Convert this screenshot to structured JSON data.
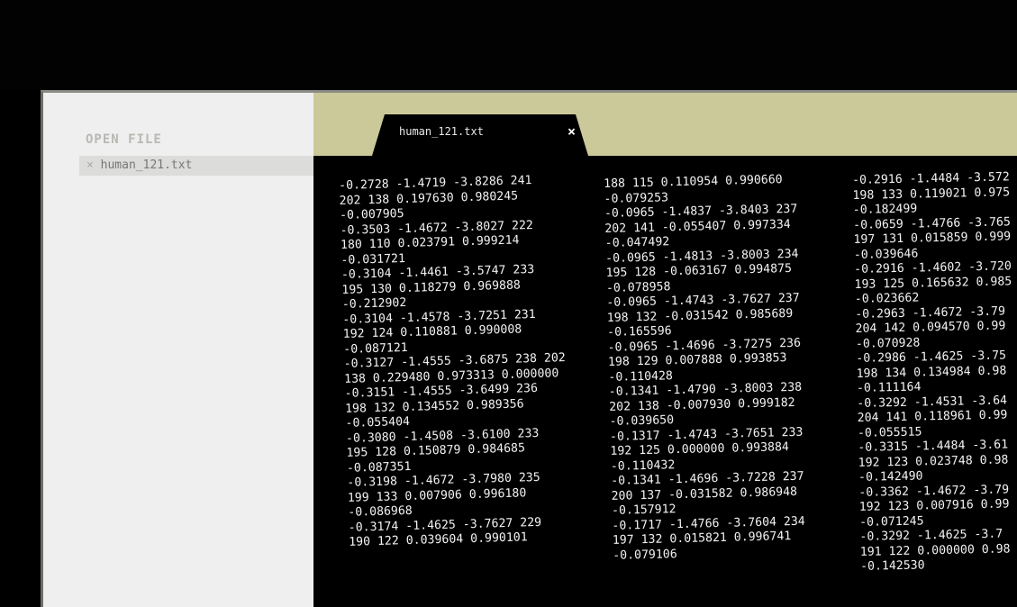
{
  "sidebar": {
    "heading": "OPEN FILE",
    "files": [
      {
        "close_glyph": "×",
        "name": "human_121.txt"
      }
    ]
  },
  "tab": {
    "title": "human_121.txt",
    "close_glyph": "×"
  },
  "editor": {
    "columns": [
      "-0.2728 -1.4719 -3.8286 241\n202 138 0.197630 0.980245\n-0.007905\n-0.3503 -1.4672 -3.8027 222\n180 110 0.023791 0.999214\n-0.031721\n-0.3104 -1.4461 -3.5747 233\n195 130 0.118279 0.969888\n-0.212902\n-0.3104 -1.4578 -3.7251 231\n192 124 0.110881 0.990008\n-0.087121\n-0.3127 -1.4555 -3.6875 238 202\n138 0.229480 0.973313 0.000000\n-0.3151 -1.4555 -3.6499 236\n198 132 0.134552 0.989356\n-0.055404\n-0.3080 -1.4508 -3.6100 233\n195 128 0.150879 0.984685\n-0.087351\n-0.3198 -1.4672 -3.7980 235\n199 133 0.007906 0.996180\n-0.086968\n-0.3174 -1.4625 -3.7627 229\n190 122 0.039604 0.990101",
      "188 115 0.110954 0.990660\n-0.079253\n-0.0965 -1.4837 -3.8403 237\n202 141 -0.055407 0.997334\n-0.047492\n-0.0965 -1.4813 -3.8003 234\n195 128 -0.063167 0.994875\n-0.078958\n-0.0965 -1.4743 -3.7627 237\n198 132 -0.031542 0.985689\n-0.165596\n-0.0965 -1.4696 -3.7275 236\n198 129 0.007888 0.993853\n-0.110428\n-0.1341 -1.4790 -3.8003 238\n202 138 -0.007930 0.999182\n-0.039650\n-0.1317 -1.4743 -3.7651 233\n192 125 0.000000 0.993884\n-0.110432\n-0.1341 -1.4696 -3.7228 237\n200 137 -0.031582 0.986948\n-0.157912\n-0.1717 -1.4766 -3.7604 234\n197 132 0.015821 0.996741\n-0.079106",
      "-0.2916 -1.4484 -3.572\n198 133 0.119021 0.975\n-0.182499\n-0.0659 -1.4766 -3.765\n197 131 0.015859 0.999\n-0.039646\n-0.2916 -1.4602 -3.720\n193 125 0.165632 0.985\n-0.023662\n-0.2963 -1.4672 -3.79\n204 142 0.094570 0.99\n-0.070928\n-0.2986 -1.4625 -3.75\n198 134 0.134984 0.98\n-0.111164\n-0.3292 -1.4531 -3.64\n204 141 0.118961 0.99\n-0.055515\n-0.3315 -1.4484 -3.61\n192 123 0.023748 0.98\n-0.142490\n-0.3362 -1.4672 -3.79\n192 123 0.007916 0.99\n-0.071245\n-0.3292 -1.4625 -3.7\n191 122 0.000000 0.98\n-0.142530"
    ]
  }
}
